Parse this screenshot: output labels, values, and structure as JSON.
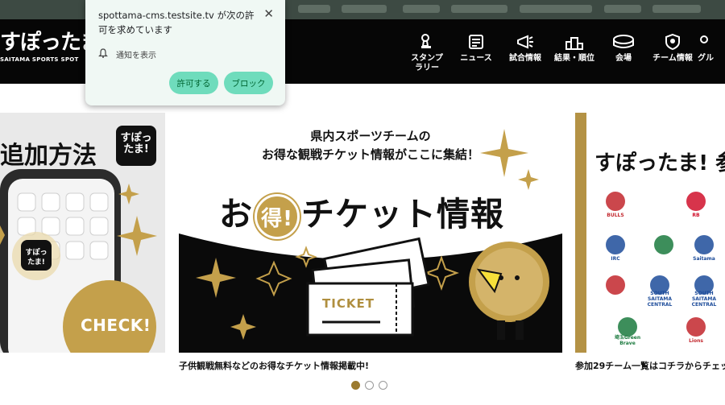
{
  "site": {
    "logo_main": "すぽったま!",
    "logo_sub": "SAITAMA SPORTS SPOT"
  },
  "nav": [
    {
      "label": "スタンプ\nラリー",
      "icon": "stamp-icon"
    },
    {
      "label": "ニュース",
      "icon": "news-icon"
    },
    {
      "label": "試合情報",
      "icon": "megaphone-icon"
    },
    {
      "label": "結果・順位",
      "icon": "podium-icon"
    },
    {
      "label": "会場",
      "icon": "stadium-icon"
    },
    {
      "label": "チーム情報",
      "icon": "shield-icon"
    },
    {
      "label": "グル",
      "icon": "group-icon"
    }
  ],
  "popup": {
    "title": "spottama-cms.testsite.tv が次の許可を求めています",
    "notification_label": "通知を表示",
    "allow_label": "許可する",
    "block_label": "ブロック"
  },
  "carousel": {
    "left": {
      "title": "追加方法",
      "badge": "すぽったま!",
      "check": "CHECK!"
    },
    "center": {
      "sub1": "県内スポーツチームの",
      "sub2": "お得な観戦チケット情報がここに集結！",
      "main_prefix": "お",
      "main_circle": "得!",
      "main_suffix": "チケット情報",
      "ticket": "TICKET",
      "caption": "子供観戦無料などのお得なチケット情報掲載中!"
    },
    "right": {
      "title": "すぽったま! 参",
      "caption": "参加29チーム一覧はコチラからチェッ",
      "teams": [
        {
          "name": "BULLS",
          "color": "#c2272d"
        },
        {
          "name": "RB",
          "color": "#d0112b"
        },
        {
          "name": "IRC",
          "color": "#1d4c9a"
        },
        {
          "name": "",
          "color": "#1b7a3e"
        },
        {
          "name": "Saitama",
          "color": "#1d4c9a"
        },
        {
          "name": "",
          "color": "#c2272d"
        },
        {
          "name": "SOUTH SAITAMA CENTRAL",
          "color": "#1d4c9a"
        },
        {
          "name": "SOUTH SAITAMA CENTRAL",
          "color": "#1d4c9a"
        },
        {
          "name": "埼玉Green Brave",
          "color": "#1b7a3e"
        },
        {
          "name": "Lions",
          "color": "#c2272d"
        }
      ]
    },
    "active_dot": 0,
    "dot_count": 3
  },
  "colors": {
    "header_bg": "#060606",
    "gold": "#c4a04b",
    "popup_button": "#6fdcbc"
  }
}
